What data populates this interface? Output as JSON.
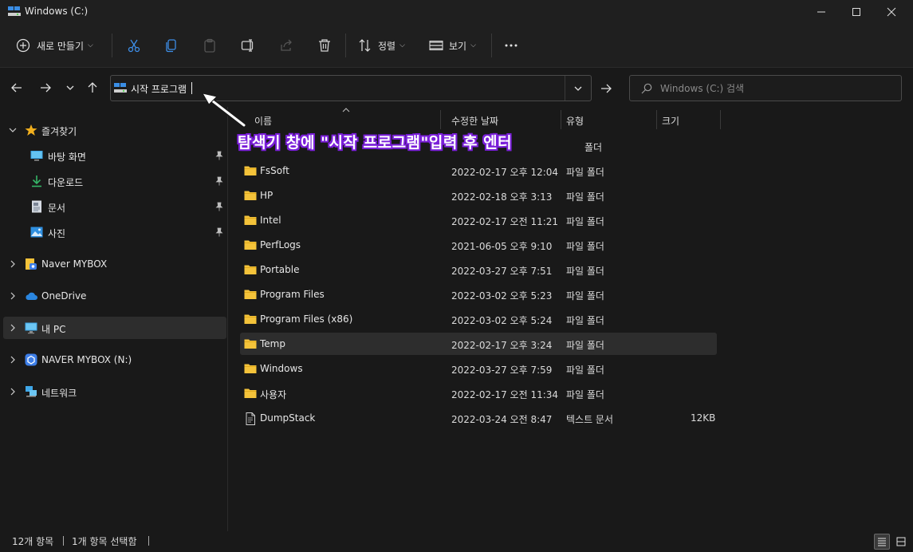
{
  "window": {
    "title": "Windows (C:)"
  },
  "toolbar": {
    "new_label": "새로 만들기",
    "sort_label": "정렬",
    "view_label": "보기"
  },
  "address": {
    "path": "시작 프로그램",
    "search_placeholder": "Windows (C:) 검색"
  },
  "sidebar": {
    "quick_access": "즐겨찾기",
    "quick_items": [
      {
        "label": "바탕 화면",
        "icon": "desktop-icon"
      },
      {
        "label": "다운로드",
        "icon": "download-icon"
      },
      {
        "label": "문서",
        "icon": "documents-icon"
      },
      {
        "label": "사진",
        "icon": "pictures-icon"
      }
    ],
    "naver_mybox": "Naver MYBOX",
    "onedrive": "OneDrive",
    "this_pc": "내 PC",
    "naver_drive": "NAVER MYBOX (N:)",
    "network": "네트워크"
  },
  "columns": {
    "name": "이름",
    "date": "수정한 날짜",
    "type": "유형",
    "size": "크기"
  },
  "files": [
    {
      "name": "FsSoft",
      "date": "2022-02-17 오후 12:04",
      "type": "파일 폴더",
      "size": ""
    },
    {
      "name": "HP",
      "date": "2022-02-18 오후 3:13",
      "type": "파일 폴더",
      "size": ""
    },
    {
      "name": "Intel",
      "date": "2022-02-17 오전 11:21",
      "type": "파일 폴더",
      "size": ""
    },
    {
      "name": "PerfLogs",
      "date": "2021-06-05 오후 9:10",
      "type": "파일 폴더",
      "size": ""
    },
    {
      "name": "Portable",
      "date": "2022-03-27 오후 7:51",
      "type": "파일 폴더",
      "size": ""
    },
    {
      "name": "Program Files",
      "date": "2022-03-02 오후 5:23",
      "type": "파일 폴더",
      "size": ""
    },
    {
      "name": "Program Files (x86)",
      "date": "2022-03-02 오후 5:24",
      "type": "파일 폴더",
      "size": ""
    },
    {
      "name": "Temp",
      "date": "2022-02-17 오후 3:24",
      "type": "파일 폴더",
      "size": ""
    },
    {
      "name": "Windows",
      "date": "2022-03-27 오후 7:59",
      "type": "파일 폴더",
      "size": ""
    },
    {
      "name": "사용자",
      "date": "2022-02-17 오전 11:34",
      "type": "파일 폴더",
      "size": ""
    },
    {
      "name": "DumpStack",
      "date": "2022-03-24 오전 8:47",
      "type": "텍스트 문서",
      "size": "12KB"
    }
  ],
  "partial_first_row_type": "폴더",
  "annotation": "탐색기 창에 \"시작 프로그램\"입력 후 엔터",
  "status": {
    "item_count": "12개 항목",
    "selection": "1개 항목 선택함"
  },
  "colors": {
    "background": "#191919",
    "selected_row": "#2d2d2d",
    "folder_yellow": "#f4c33a",
    "annotation_outline": "#7a1fd9",
    "star": "#f2b01e"
  }
}
